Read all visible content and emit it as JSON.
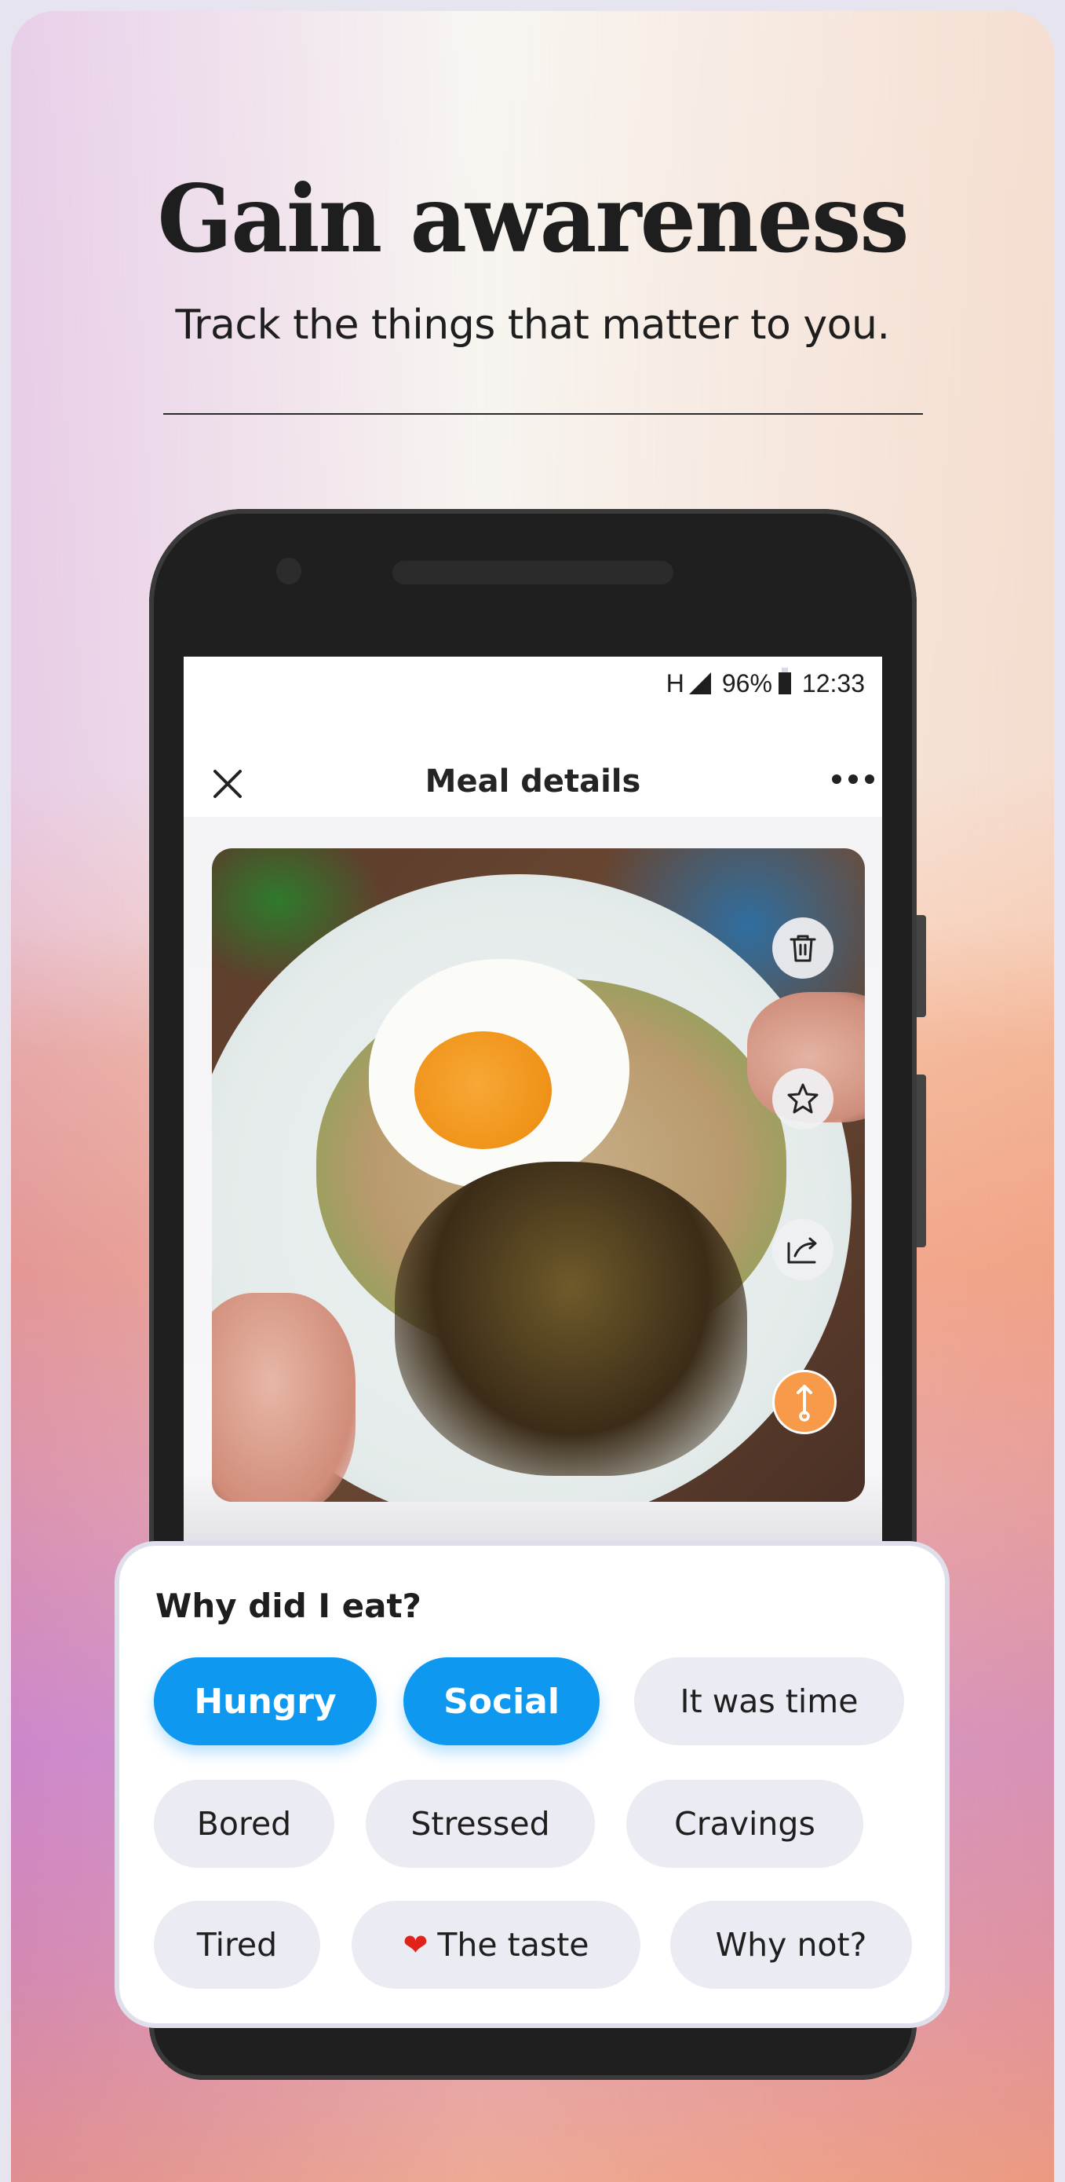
{
  "headline": "Gain awareness",
  "subheadline": "Track the things that matter to you.",
  "status_bar": {
    "network": "H",
    "battery": "96%",
    "time": "12:33"
  },
  "app_bar": {
    "title": "Meal details",
    "close_icon": "close-icon",
    "more_icon": "more-horizontal-icon"
  },
  "photo": {
    "description": "Bowl with fried egg, cauliflower rice, edamame and roasted brussels sprouts",
    "actions": [
      {
        "name": "delete",
        "icon": "trash-icon"
      },
      {
        "name": "favorite",
        "icon": "star-icon"
      },
      {
        "name": "share",
        "icon": "share-icon"
      },
      {
        "name": "reposition",
        "icon": "pin-arrow-icon",
        "color": "#f79b4a"
      }
    ]
  },
  "sheet": {
    "title": "Why did I eat?",
    "chips": [
      {
        "label": "Hungry",
        "selected": true
      },
      {
        "label": "Social",
        "selected": true
      },
      {
        "label": "It was time",
        "selected": false
      },
      {
        "label": "Bored",
        "selected": false
      },
      {
        "label": "Stressed",
        "selected": false
      },
      {
        "label": "Cravings",
        "selected": false
      },
      {
        "label": "Tired",
        "selected": false
      },
      {
        "label": "The taste",
        "emoji": "❤",
        "selected": false
      },
      {
        "label": "Why not?",
        "selected": false
      }
    ]
  },
  "colors": {
    "accent_blue": "#0e98ef",
    "accent_orange": "#f79b4a",
    "chip_bg": "#ebecf3",
    "text_dark": "#1e1e1e"
  }
}
